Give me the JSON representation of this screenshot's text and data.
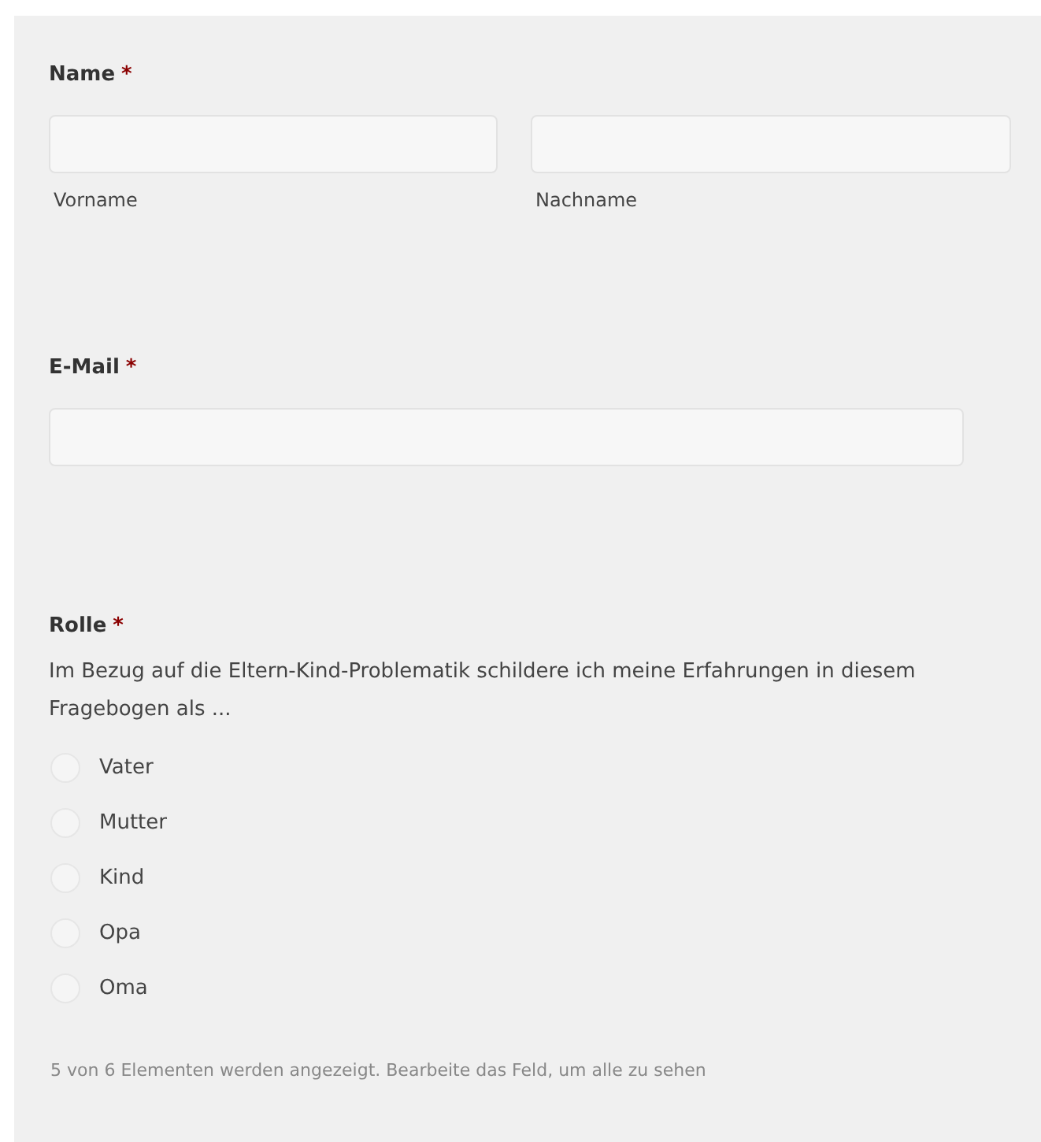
{
  "fields": [
    {
      "kind": "name",
      "label": "Name",
      "required_mark": "*",
      "inputs": [
        {
          "sublabel": "Vorname"
        },
        {
          "sublabel": "Nachname"
        }
      ]
    },
    {
      "kind": "email",
      "label": "E-Mail",
      "required_mark": "*"
    },
    {
      "kind": "radio",
      "label": "Rolle",
      "required_mark": "*",
      "description": "Im Bezug auf die Eltern-Kind-Problematik schildere ich meine Erfahrungen in diesem Fragebogen als ...",
      "options": [
        {
          "label": "Vater",
          "selected": false
        },
        {
          "label": "Mutter",
          "selected": false
        },
        {
          "label": "Kind",
          "selected": false
        },
        {
          "label": "Opa",
          "selected": false
        },
        {
          "label": "Oma",
          "selected": false
        }
      ],
      "note": "5 von 6 Elementen werden angezeigt. Bearbeite das Feld, um alle zu sehen"
    }
  ]
}
